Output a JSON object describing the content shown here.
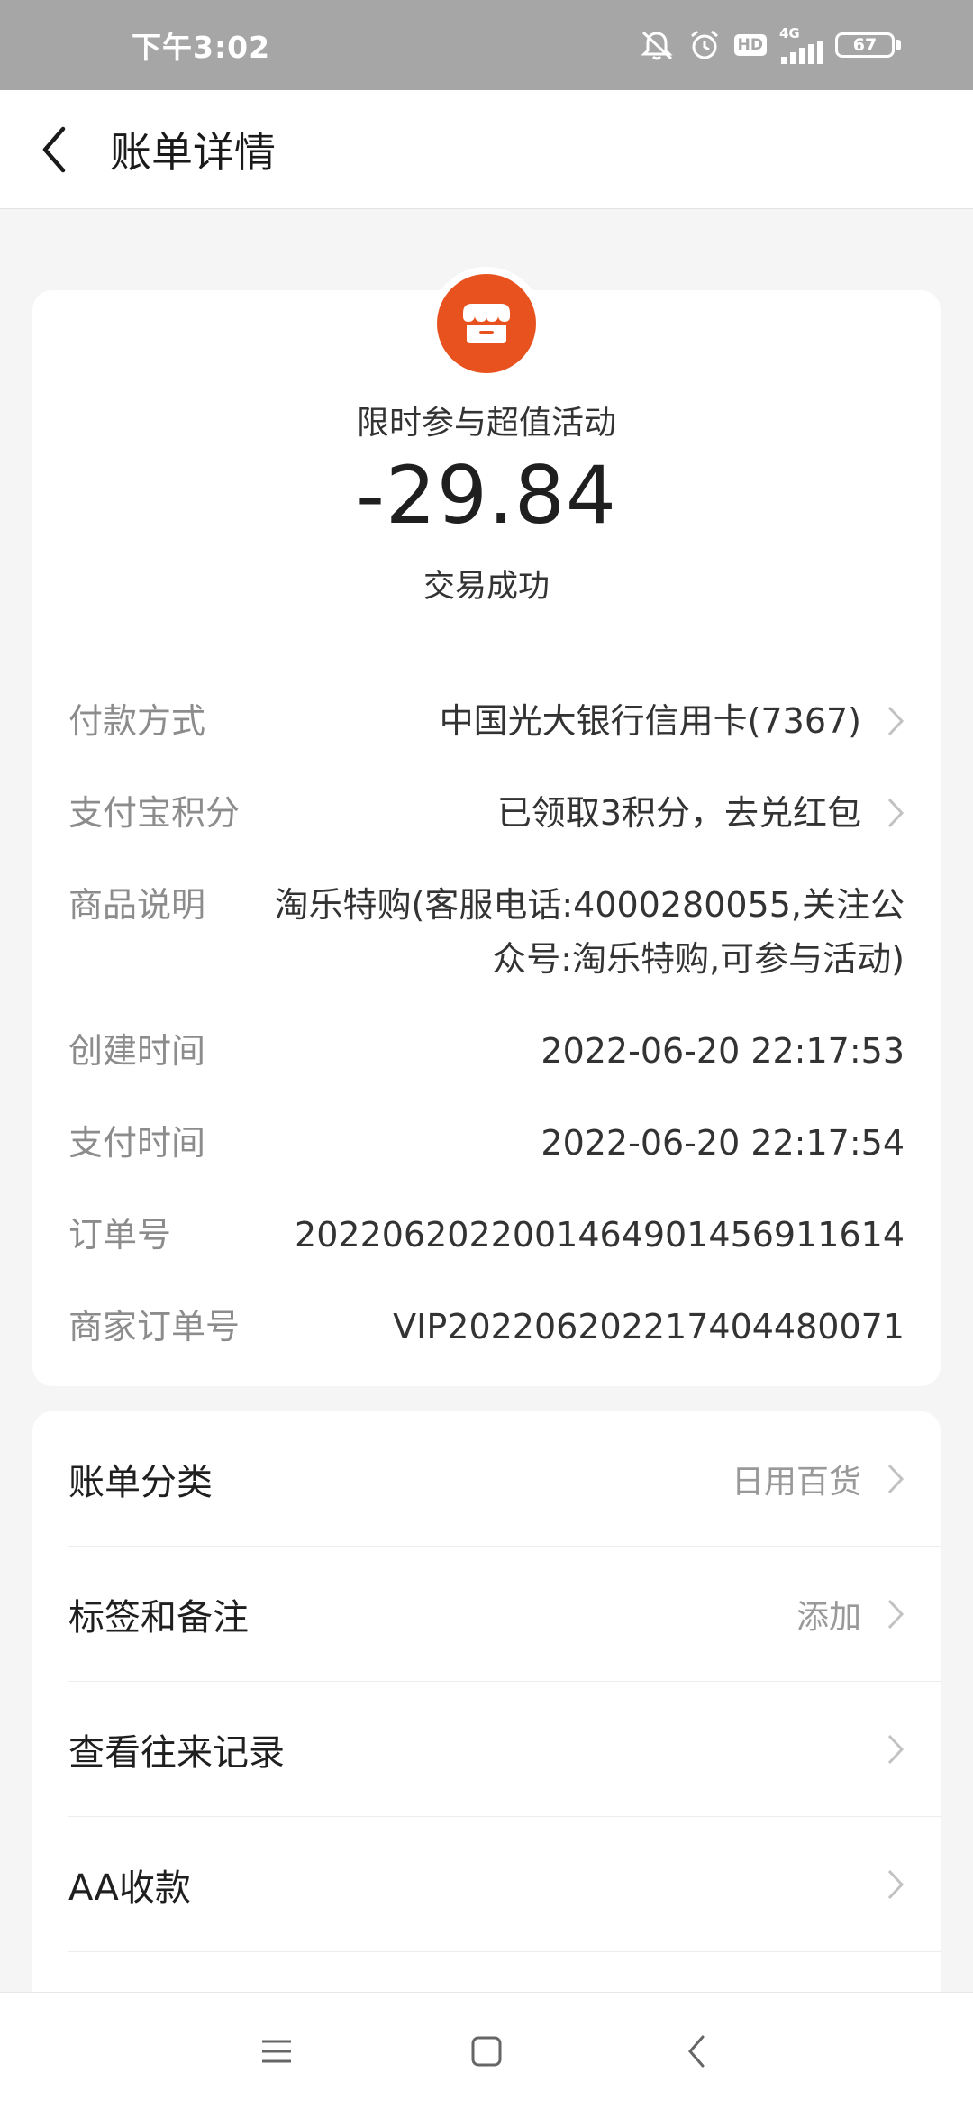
{
  "status_bar": {
    "time": "下午3:02",
    "network": "4G",
    "hd": "HD",
    "battery": "67"
  },
  "header": {
    "title": "账单详情"
  },
  "summary": {
    "merchant_name": "限时参与超值活动",
    "amount": "-29.84",
    "status": "交易成功"
  },
  "details": [
    {
      "label": "付款方式",
      "value": "中国光大银行信用卡(7367)"
    },
    {
      "label": "支付宝积分",
      "value": "已领取3积分，去兑红包"
    },
    {
      "label": "商品说明",
      "value": "淘乐特购(客服电话:4000280055,关注公众号:淘乐特购,可参与活动)"
    },
    {
      "label": "创建时间",
      "value": "2022-06-20 22:17:53"
    },
    {
      "label": "支付时间",
      "value": "2022-06-20 22:17:54"
    },
    {
      "label": "订单号",
      "value": "2022062022001464901456911614"
    },
    {
      "label": "商家订单号",
      "value": "VIP20220620221740448007​1"
    }
  ],
  "actions": [
    {
      "label": "账单分类",
      "value": "日用百货"
    },
    {
      "label": "标签和备注",
      "value": "添加"
    },
    {
      "label": "查看往来记录",
      "value": ""
    },
    {
      "label": "AA收款",
      "value": ""
    }
  ],
  "colors": {
    "status_bar_bg": "#a6a6a6",
    "merchant_logo": "#e8521f",
    "label_gray": "#8c8c8c",
    "page_bg": "#f5f5f5"
  }
}
